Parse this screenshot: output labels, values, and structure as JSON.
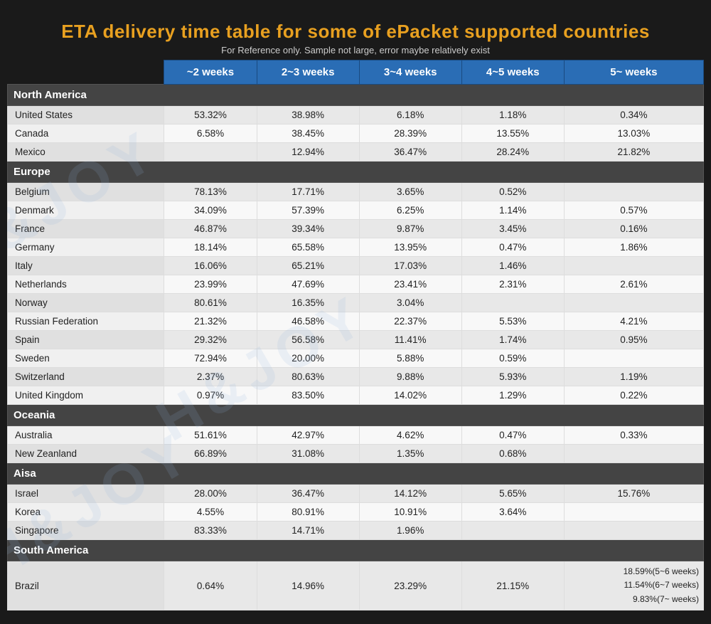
{
  "title": {
    "main_text": "ETA delivery time table for some of ",
    "highlight": "ePacket",
    "main_text_end": " supported countries",
    "subtitle": "For Reference only. Sample not large, error maybe relatively exist"
  },
  "watermark": "H&JOY",
  "headers": {
    "col0": "",
    "col1": "~2 weeks",
    "col2": "2~3 weeks",
    "col3": "3~4 weeks",
    "col4": "4~5 weeks",
    "col5": "5~  weeks"
  },
  "sections": [
    {
      "name": "North America",
      "rows": [
        {
          "country": "United States",
          "c1": "53.32%",
          "c2": "38.98%",
          "c3": "6.18%",
          "c4": "1.18%",
          "c5": "0.34%"
        },
        {
          "country": "Canada",
          "c1": "6.58%",
          "c2": "38.45%",
          "c3": "28.39%",
          "c4": "13.55%",
          "c5": "13.03%"
        },
        {
          "country": "Mexico",
          "c1": "",
          "c2": "12.94%",
          "c3": "36.47%",
          "c4": "28.24%",
          "c5": "21.82%"
        }
      ]
    },
    {
      "name": "Europe",
      "rows": [
        {
          "country": "Belgium",
          "c1": "78.13%",
          "c2": "17.71%",
          "c3": "3.65%",
          "c4": "0.52%",
          "c5": ""
        },
        {
          "country": "Denmark",
          "c1": "34.09%",
          "c2": "57.39%",
          "c3": "6.25%",
          "c4": "1.14%",
          "c5": "0.57%"
        },
        {
          "country": "France",
          "c1": "46.87%",
          "c2": "39.34%",
          "c3": "9.87%",
          "c4": "3.45%",
          "c5": "0.16%"
        },
        {
          "country": "Germany",
          "c1": "18.14%",
          "c2": "65.58%",
          "c3": "13.95%",
          "c4": "0.47%",
          "c5": "1.86%"
        },
        {
          "country": "Italy",
          "c1": "16.06%",
          "c2": "65.21%",
          "c3": "17.03%",
          "c4": "1.46%",
          "c5": ""
        },
        {
          "country": "Netherlands",
          "c1": "23.99%",
          "c2": "47.69%",
          "c3": "23.41%",
          "c4": "2.31%",
          "c5": "2.61%"
        },
        {
          "country": "Norway",
          "c1": "80.61%",
          "c2": "16.35%",
          "c3": "3.04%",
          "c4": "",
          "c5": ""
        },
        {
          "country": "Russian Federation",
          "c1": "21.32%",
          "c2": "46.58%",
          "c3": "22.37%",
          "c4": "5.53%",
          "c5": "4.21%"
        },
        {
          "country": "Spain",
          "c1": "29.32%",
          "c2": "56.58%",
          "c3": "11.41%",
          "c4": "1.74%",
          "c5": "0.95%"
        },
        {
          "country": "Sweden",
          "c1": "72.94%",
          "c2": "20.00%",
          "c3": "5.88%",
          "c4": "0.59%",
          "c5": ""
        },
        {
          "country": "Switzerland",
          "c1": "2.37%",
          "c2": "80.63%",
          "c3": "9.88%",
          "c4": "5.93%",
          "c5": "1.19%"
        },
        {
          "country": "United Kingdom",
          "c1": "0.97%",
          "c2": "83.50%",
          "c3": "14.02%",
          "c4": "1.29%",
          "c5": "0.22%"
        }
      ]
    },
    {
      "name": "Oceania",
      "rows": [
        {
          "country": "Australia",
          "c1": "51.61%",
          "c2": "42.97%",
          "c3": "4.62%",
          "c4": "0.47%",
          "c5": "0.33%"
        },
        {
          "country": "New Zeanland",
          "c1": "66.89%",
          "c2": "31.08%",
          "c3": "1.35%",
          "c4": "0.68%",
          "c5": ""
        }
      ]
    },
    {
      "name": "Aisa",
      "rows": [
        {
          "country": "Israel",
          "c1": "28.00%",
          "c2": "36.47%",
          "c3": "14.12%",
          "c4": "5.65%",
          "c5": "15.76%"
        },
        {
          "country": "Korea",
          "c1": "4.55%",
          "c2": "80.91%",
          "c3": "10.91%",
          "c4": "3.64%",
          "c5": ""
        },
        {
          "country": "Singapore",
          "c1": "83.33%",
          "c2": "14.71%",
          "c3": "1.96%",
          "c4": "",
          "c5": ""
        }
      ]
    },
    {
      "name": "South America",
      "rows": [
        {
          "country": "Brazil",
          "c1": "0.64%",
          "c2": "14.96%",
          "c3": "23.29%",
          "c4": "21.15%",
          "c5": "18.59%(5~6 weeks)\n11.54%(6~7 weeks)\n9.83%(7~ weeks)",
          "special": true
        }
      ]
    }
  ]
}
